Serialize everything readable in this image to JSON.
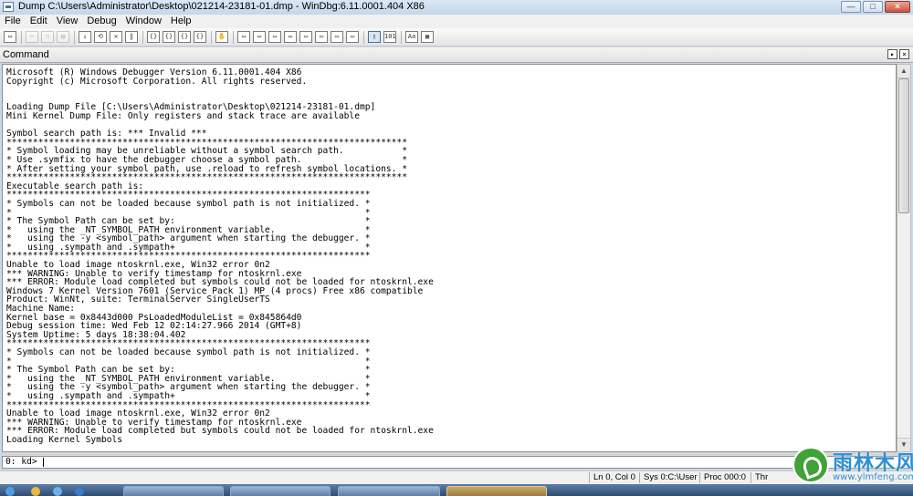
{
  "window": {
    "title": "Dump C:\\Users\\Administrator\\Desktop\\021214-23181-01.dmp - WinDbg:6.11.0001.404 X86",
    "buttons": {
      "minimize": "—",
      "maximize": "□",
      "close": "✕"
    }
  },
  "menu": [
    "File",
    "Edit",
    "View",
    "Debug",
    "Window",
    "Help"
  ],
  "toolbar_icons": [
    {
      "name": "open-icon",
      "glyph": "▭",
      "disabled": false
    },
    {
      "name": "cut-icon",
      "glyph": "✂",
      "disabled": true
    },
    {
      "name": "copy-icon",
      "glyph": "❐",
      "disabled": true
    },
    {
      "name": "paste-icon",
      "glyph": "▤",
      "disabled": true
    },
    {
      "name": "go-icon",
      "glyph": "↓",
      "disabled": false
    },
    {
      "name": "restart-icon",
      "glyph": "⟲",
      "disabled": false
    },
    {
      "name": "stop-debugging-icon",
      "glyph": "✕",
      "disabled": false
    },
    {
      "name": "break-icon",
      "glyph": "‖",
      "disabled": false
    },
    {
      "name": "step-into-icon",
      "glyph": "{}",
      "disabled": false
    },
    {
      "name": "step-over-icon",
      "glyph": "{}",
      "disabled": false
    },
    {
      "name": "step-out-icon",
      "glyph": "{}",
      "disabled": false
    },
    {
      "name": "run-to-cursor-icon",
      "glyph": "{}",
      "disabled": false
    },
    {
      "name": "breakpoint-hand-icon",
      "glyph": "✋",
      "disabled": false
    },
    {
      "name": "command-window-icon",
      "glyph": "▭",
      "disabled": false
    },
    {
      "name": "watch-window-icon",
      "glyph": "▭",
      "disabled": false
    },
    {
      "name": "locals-window-icon",
      "glyph": "▭",
      "disabled": false
    },
    {
      "name": "registers-window-icon",
      "glyph": "▭",
      "disabled": false
    },
    {
      "name": "memory-window-icon",
      "glyph": "▭",
      "disabled": false
    },
    {
      "name": "call-stack-window-icon",
      "glyph": "▭",
      "disabled": false
    },
    {
      "name": "disassembly-window-icon",
      "glyph": "▭",
      "disabled": false
    },
    {
      "name": "scratch-pad-icon",
      "glyph": "▭",
      "disabled": false
    },
    {
      "name": "source-mode-icon",
      "glyph": "▯",
      "disabled": false,
      "pressed": true
    },
    {
      "name": "hex-mode-icon",
      "glyph": "101",
      "disabled": false
    },
    {
      "name": "font-icon",
      "glyph": "Aa",
      "disabled": false
    },
    {
      "name": "options-icon",
      "glyph": "▦",
      "disabled": false
    }
  ],
  "command_pane": {
    "title": "Command",
    "output_lines": [
      "Microsoft (R) Windows Debugger Version 6.11.0001.404 X86",
      "Copyright (c) Microsoft Corporation. All rights reserved.",
      "",
      "",
      "Loading Dump File [C:\\Users\\Administrator\\Desktop\\021214-23181-01.dmp]",
      "Mini Kernel Dump File: Only registers and stack trace are available",
      "",
      "Symbol search path is: *** Invalid ***",
      "****************************************************************************",
      "* Symbol loading may be unreliable without a symbol search path.           *",
      "* Use .symfix to have the debugger choose a symbol path.                   *",
      "* After setting your symbol path, use .reload to refresh symbol locations. *",
      "****************************************************************************",
      "Executable search path is:",
      "*********************************************************************",
      "* Symbols can not be loaded because symbol path is not initialized. *",
      "*                                                                   *",
      "* The Symbol Path can be set by:                                    *",
      "*   using the _NT_SYMBOL_PATH environment variable.                 *",
      "*   using the -y <symbol_path> argument when starting the debugger. *",
      "*   using .sympath and .sympath+                                    *",
      "*********************************************************************",
      "Unable to load image ntoskrnl.exe, Win32 error 0n2",
      "*** WARNING: Unable to verify timestamp for ntoskrnl.exe",
      "*** ERROR: Module load completed but symbols could not be loaded for ntoskrnl.exe",
      "Windows 7 Kernel Version 7601 (Service Pack 1) MP (4 procs) Free x86 compatible",
      "Product: WinNt, suite: TerminalServer SingleUserTS",
      "Machine Name:",
      "Kernel base = 0x8443d000 PsLoadedModuleList = 0x845864d0",
      "Debug session time: Wed Feb 12 02:14:27.966 2014 (GMT+8)",
      "System Uptime: 5 days 18:38:04.402",
      "*********************************************************************",
      "* Symbols can not be loaded because symbol path is not initialized. *",
      "*                                                                   *",
      "* The Symbol Path can be set by:                                    *",
      "*   using the _NT_SYMBOL_PATH environment variable.                 *",
      "*   using the -y <symbol_path> argument when starting the debugger. *",
      "*   using .sympath and .sympath+                                    *",
      "*********************************************************************",
      "Unable to load image ntoskrnl.exe, Win32 error 0n2",
      "*** WARNING: Unable to verify timestamp for ntoskrnl.exe",
      "*** ERROR: Module load completed but symbols could not be loaded for ntoskrnl.exe",
      "Loading Kernel Symbols"
    ],
    "prompt": "0: kd>",
    "input_value": ""
  },
  "status": {
    "position": "Ln 0, Col 0",
    "sys": "Sys 0:C:\\User",
    "proc": "Proc 000:0",
    "thrd": "Thr"
  },
  "watermark": {
    "name": "雨林木风",
    "url": "www.ylmfeng.com"
  }
}
